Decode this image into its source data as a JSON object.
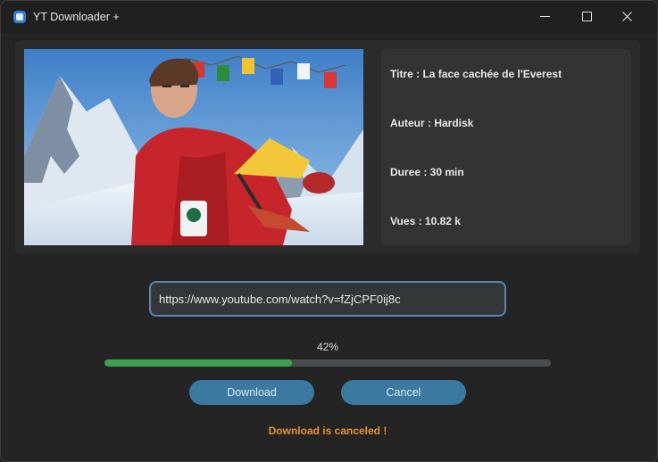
{
  "window": {
    "title": "YT Downloader +"
  },
  "video": {
    "title_line": "Titre : La face cachée de l'Everest",
    "author_line": "Auteur : Hardisk",
    "duration_line": "Duree : 30 min",
    "views_line": "Vues : 10.82 k"
  },
  "url_input": {
    "value": "https://www.youtube.com/watch?v=fZjCPF0ij8c"
  },
  "progress": {
    "label": "42%",
    "fraction": 0.42,
    "color": "#3fa34d"
  },
  "buttons": {
    "download_label": "Download",
    "cancel_label": "Cancel"
  },
  "status": {
    "text": "Download is canceled !",
    "color": "#e8912e"
  },
  "colors": {
    "accent": "#3b79a0",
    "input_border": "#5b86b2",
    "background": "#242424"
  }
}
